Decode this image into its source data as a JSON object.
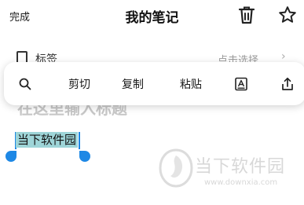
{
  "header": {
    "done_label": "完成",
    "title": "我的笔记",
    "delete_icon": "trash-icon",
    "favorite_icon": "star-icon"
  },
  "tag_row": {
    "label": "标签",
    "hint": "点击选择",
    "chevron": "›"
  },
  "editor": {
    "title_placeholder": "在这里输入标题",
    "selected_text": "当下软件园"
  },
  "context_toolbar": {
    "items": [
      {
        "icon": "search-icon"
      },
      {
        "label": "剪切"
      },
      {
        "label": "复制"
      },
      {
        "label": "粘贴"
      },
      {
        "icon": "text-format-icon"
      },
      {
        "icon": "share-icon"
      }
    ]
  },
  "watermark": {
    "name": "当下软件园",
    "url": "www.downxia.com"
  },
  "colors": {
    "selection": "#9ed5d8",
    "handle": "#1e88e5",
    "watermark": "#d8d8d8"
  }
}
